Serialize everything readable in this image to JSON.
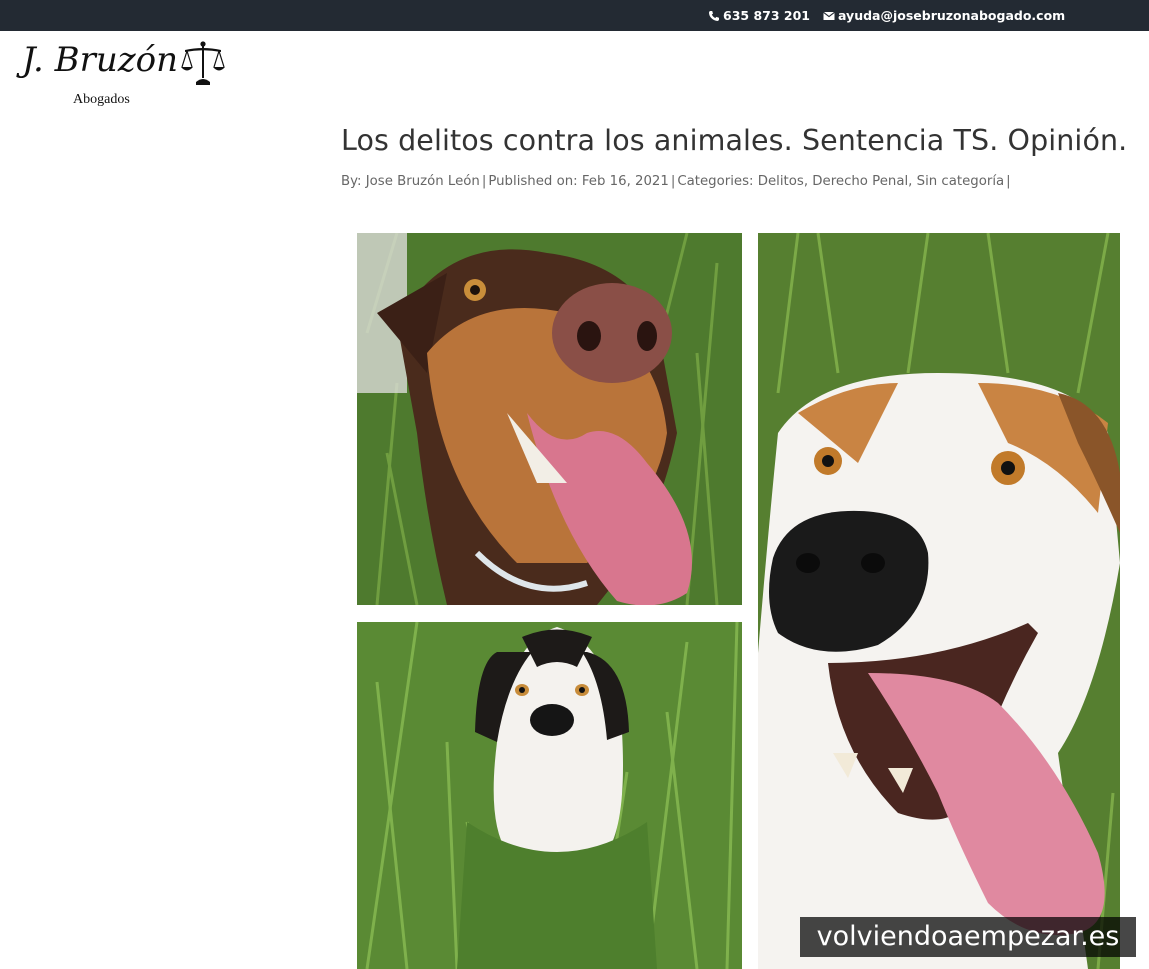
{
  "topbar": {
    "phone": "635 873 201",
    "email": "ayuda@josebruzonabogado.com",
    "phone_icon": "phone-icon",
    "email_icon": "envelope-icon"
  },
  "logo": {
    "name": "J. Bruzón",
    "subtitle": "Abogados",
    "icon": "scales-of-justice-icon"
  },
  "post": {
    "title": "Los delitos contra los animales. Sentencia TS. Opinión.",
    "by_label": "By:",
    "author": "Jose Bruzón León",
    "published_label": "Published on:",
    "date": "Feb 16, 2021",
    "categories_label": "Categories:",
    "categories": [
      "Delitos",
      "Derecho Penal",
      "Sin categoría"
    ]
  },
  "watermark": "volviendoaempezar.es",
  "colors": {
    "topbar_bg": "#232a33",
    "title_text": "#333333",
    "meta_text": "#666666"
  }
}
